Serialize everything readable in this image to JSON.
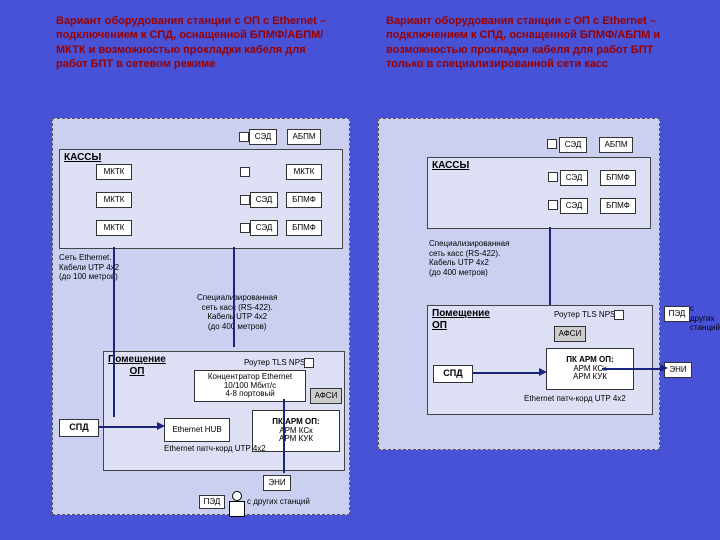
{
  "titles": {
    "left": "Вариант оборудования станции с ОП с Ethernet – подключением к СПД, оснащенной БПМФ/АБПМ/МКТК и возможностью прокладки кабеля для работ БПТ в сетевом режиме",
    "right": "Вариант оборудования станции с ОП с Ethernet – подключением к СПД, оснащенной БПМФ/АБПМ и возможностью прокладки кабеля для работ БПТ только в специализированной сети касс"
  },
  "common": {
    "kassy": "КАССЫ",
    "op_room": "Помещение ОП",
    "spd": "СПД",
    "hub": "Ethernet HUB",
    "patch": "Ethernet патч-корд UTP 4x2",
    "router": "Роутер TLS NPS",
    "pc_arm": "ПК АРМ ОП:",
    "arm_ksk": "АРМ КСк",
    "arm_kuk": "АРМ КУК",
    "afsi": "АФСИ",
    "eni": "ЭНИ",
    "ped": "ПЭД",
    "other_sta": "с других станций"
  },
  "left": {
    "cable_eth": "Сеть Ethernet.\nКабели UTP 4x2\n(до 100 метров)",
    "spec_net": "Специализированная\nсеть касс (RS-422).\nКабель UTP 4x2\n(до 400 метров)",
    "konc": "Концентратор Ethernet\n10/100 Мбит/с\n4-8 портовый",
    "mktk": "МКТК",
    "sed": "СЭД",
    "abpm": "АБПМ",
    "bpmf": "БПМФ"
  },
  "right": {
    "spec_net": "Специализированная\nсеть касс (RS-422).\nКабель UTP 4x2\n(до 400 метров)",
    "sed": "СЭД",
    "abpm": "АБПМ",
    "bpmf": "БПМФ"
  }
}
